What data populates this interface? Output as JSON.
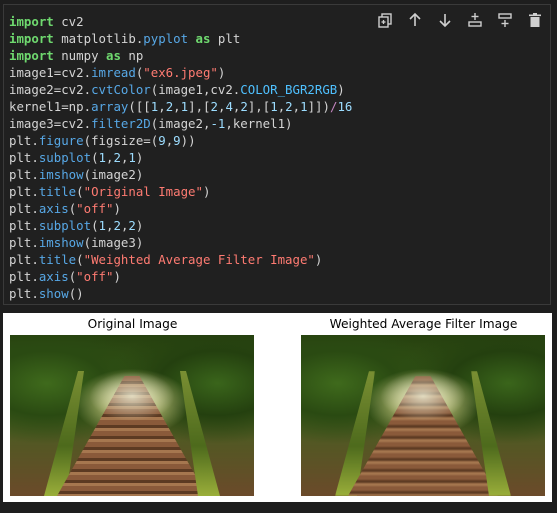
{
  "toolbar": {
    "icons": [
      "duplicate-icon",
      "move-up-icon",
      "move-down-icon",
      "insert-above-icon",
      "insert-below-icon",
      "delete-icon"
    ]
  },
  "code": {
    "lines": [
      [
        {
          "t": "import",
          "c": "kw"
        },
        {
          "t": " cv2",
          "c": ""
        }
      ],
      [
        {
          "t": "import",
          "c": "kw"
        },
        {
          "t": " matplotlib.",
          "c": ""
        },
        {
          "t": "pyplot",
          "c": "fn"
        },
        {
          "t": " ",
          "c": ""
        },
        {
          "t": "as",
          "c": "kw"
        },
        {
          "t": " plt",
          "c": ""
        }
      ],
      [
        {
          "t": "import",
          "c": "kw"
        },
        {
          "t": " numpy ",
          "c": ""
        },
        {
          "t": "as",
          "c": "kw"
        },
        {
          "t": " np",
          "c": ""
        }
      ],
      [
        {
          "t": "image1=cv2.",
          "c": ""
        },
        {
          "t": "imread",
          "c": "fn"
        },
        {
          "t": "(",
          "c": ""
        },
        {
          "t": "\"ex6.jpeg\"",
          "c": "str"
        },
        {
          "t": ")",
          "c": ""
        }
      ],
      [
        {
          "t": "image2=cv2.",
          "c": ""
        },
        {
          "t": "cvtColor",
          "c": "fn"
        },
        {
          "t": "(image1,cv2.",
          "c": ""
        },
        {
          "t": "COLOR_BGR2RGB",
          "c": "cst"
        },
        {
          "t": ")",
          "c": ""
        }
      ],
      [
        {
          "t": "kernel1=np.",
          "c": ""
        },
        {
          "t": "array",
          "c": "fn"
        },
        {
          "t": "([[",
          "c": ""
        },
        {
          "t": "1",
          "c": "num"
        },
        {
          "t": ",",
          "c": ""
        },
        {
          "t": "2",
          "c": "num"
        },
        {
          "t": ",",
          "c": ""
        },
        {
          "t": "1",
          "c": "num"
        },
        {
          "t": "],[",
          "c": ""
        },
        {
          "t": "2",
          "c": "num"
        },
        {
          "t": ",",
          "c": ""
        },
        {
          "t": "4",
          "c": "num"
        },
        {
          "t": ",",
          "c": ""
        },
        {
          "t": "2",
          "c": "num"
        },
        {
          "t": "],[",
          "c": ""
        },
        {
          "t": "1",
          "c": "num"
        },
        {
          "t": ",",
          "c": ""
        },
        {
          "t": "2",
          "c": "num"
        },
        {
          "t": ",",
          "c": ""
        },
        {
          "t": "1",
          "c": "num"
        },
        {
          "t": "]])",
          "c": ""
        },
        {
          "t": "/",
          "c": "op"
        },
        {
          "t": "16",
          "c": "num"
        }
      ],
      [
        {
          "t": "image3=cv2.",
          "c": ""
        },
        {
          "t": "filter2D",
          "c": "fn"
        },
        {
          "t": "(image2,",
          "c": ""
        },
        {
          "t": "-1",
          "c": "num"
        },
        {
          "t": ",kernel1)",
          "c": ""
        }
      ],
      [
        {
          "t": "plt.",
          "c": ""
        },
        {
          "t": "figure",
          "c": "fn"
        },
        {
          "t": "(figsize=(",
          "c": ""
        },
        {
          "t": "9",
          "c": "num"
        },
        {
          "t": ",",
          "c": ""
        },
        {
          "t": "9",
          "c": "num"
        },
        {
          "t": "))",
          "c": ""
        }
      ],
      [
        {
          "t": "plt.",
          "c": ""
        },
        {
          "t": "subplot",
          "c": "fn"
        },
        {
          "t": "(",
          "c": ""
        },
        {
          "t": "1",
          "c": "num"
        },
        {
          "t": ",",
          "c": ""
        },
        {
          "t": "2",
          "c": "num"
        },
        {
          "t": ",",
          "c": ""
        },
        {
          "t": "1",
          "c": "num"
        },
        {
          "t": ")",
          "c": ""
        }
      ],
      [
        {
          "t": "plt.",
          "c": ""
        },
        {
          "t": "imshow",
          "c": "fn"
        },
        {
          "t": "(image2)",
          "c": ""
        }
      ],
      [
        {
          "t": "plt.",
          "c": ""
        },
        {
          "t": "title",
          "c": "fn"
        },
        {
          "t": "(",
          "c": ""
        },
        {
          "t": "\"Original Image\"",
          "c": "str"
        },
        {
          "t": ")",
          "c": ""
        }
      ],
      [
        {
          "t": "plt.",
          "c": ""
        },
        {
          "t": "axis",
          "c": "fn"
        },
        {
          "t": "(",
          "c": ""
        },
        {
          "t": "\"off\"",
          "c": "str"
        },
        {
          "t": ")",
          "c": ""
        }
      ],
      [
        {
          "t": "plt.",
          "c": ""
        },
        {
          "t": "subplot",
          "c": "fn"
        },
        {
          "t": "(",
          "c": ""
        },
        {
          "t": "1",
          "c": "num"
        },
        {
          "t": ",",
          "c": ""
        },
        {
          "t": "2",
          "c": "num"
        },
        {
          "t": ",",
          "c": ""
        },
        {
          "t": "2",
          "c": "num"
        },
        {
          "t": ")",
          "c": ""
        }
      ],
      [
        {
          "t": "plt.",
          "c": ""
        },
        {
          "t": "imshow",
          "c": "fn"
        },
        {
          "t": "(image3)",
          "c": ""
        }
      ],
      [
        {
          "t": "plt.",
          "c": ""
        },
        {
          "t": "title",
          "c": "fn"
        },
        {
          "t": "(",
          "c": ""
        },
        {
          "t": "\"Weighted Average Filter Image\"",
          "c": "str"
        },
        {
          "t": ")",
          "c": ""
        }
      ],
      [
        {
          "t": "plt.",
          "c": ""
        },
        {
          "t": "axis",
          "c": "fn"
        },
        {
          "t": "(",
          "c": ""
        },
        {
          "t": "\"off\"",
          "c": "str"
        },
        {
          "t": ")",
          "c": ""
        }
      ],
      [
        {
          "t": "plt.",
          "c": ""
        },
        {
          "t": "show",
          "c": "fn"
        },
        {
          "t": "()",
          "c": ""
        }
      ]
    ]
  },
  "output": {
    "left_title": "Original Image",
    "right_title": "Weighted Average Filter Image"
  },
  "colors": {
    "keyword": "#6fd96f",
    "function": "#57a8e6",
    "string": "#ff7b72",
    "cell_background": "#202020"
  }
}
